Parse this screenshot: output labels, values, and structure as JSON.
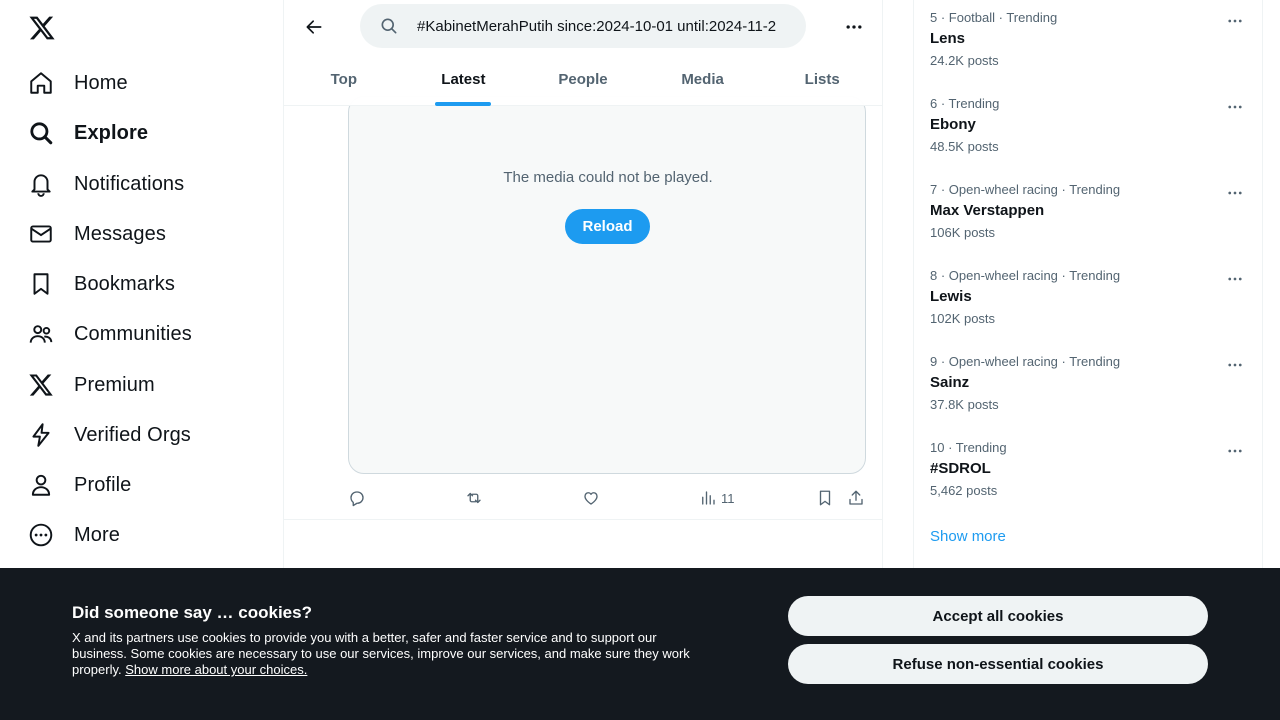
{
  "nav": {
    "items": [
      {
        "label": "Home",
        "icon": "home-icon"
      },
      {
        "label": "Explore",
        "icon": "search-icon"
      },
      {
        "label": "Notifications",
        "icon": "bell-icon"
      },
      {
        "label": "Messages",
        "icon": "envelope-icon"
      },
      {
        "label": "Bookmarks",
        "icon": "bookmark-icon"
      },
      {
        "label": "Communities",
        "icon": "people-icon"
      },
      {
        "label": "Premium",
        "icon": "x-logo-icon"
      },
      {
        "label": "Verified Orgs",
        "icon": "lightning-icon"
      },
      {
        "label": "Profile",
        "icon": "person-icon"
      },
      {
        "label": "More",
        "icon": "more-circle-icon"
      }
    ],
    "active": "Explore"
  },
  "search": {
    "value": "#KabinetMerahPutih since:2024-10-01 until:2024-11-2"
  },
  "tabs": [
    "Top",
    "Latest",
    "People",
    "Media",
    "Lists"
  ],
  "active_tab": "Latest",
  "tweet": {
    "media_error": "The media could not be played.",
    "reload_label": "Reload",
    "views": "11"
  },
  "trends": [
    {
      "meta": "5 · Football · Trending",
      "name": "Lens",
      "count": "24.2K posts"
    },
    {
      "meta": "6 · Trending",
      "name": "Ebony",
      "count": "48.5K posts"
    },
    {
      "meta": "7 · Open-wheel racing · Trending",
      "name": "Max Verstappen",
      "count": "106K posts"
    },
    {
      "meta": "8 · Open-wheel racing · Trending",
      "name": "Lewis",
      "count": "102K posts"
    },
    {
      "meta": "9 · Open-wheel racing · Trending",
      "name": "Sainz",
      "count": "37.8K posts"
    },
    {
      "meta": "10 · Trending",
      "name": "#SDROL",
      "count": "5,462 posts"
    }
  ],
  "show_more": "Show more",
  "cookie": {
    "title": "Did someone say … cookies?",
    "text": "X and its partners use cookies to provide you with a better, safer and faster service and to support our business. Some cookies are necessary to use our services, improve our services, and make sure they work properly.",
    "link": "Show more about your choices.",
    "accept": "Accept all cookies",
    "refuse": "Refuse non-essential cookies"
  },
  "colors": {
    "accent": "#1d9bf0",
    "text": "#0f1419",
    "muted": "#536471",
    "banner": "#14191f"
  }
}
